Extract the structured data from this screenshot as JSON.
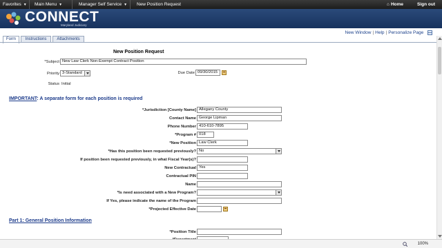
{
  "topnav": {
    "favorites": "Favorites",
    "main_menu": "Main Menu",
    "manager_self_service": "Manager Self Service",
    "breadcrumb_current": "New Position Request",
    "home": "Home",
    "sign_out": "Sign out"
  },
  "brand": {
    "name": "CONNECT",
    "subtitle": "Maryland Judiciary"
  },
  "utility": {
    "new_window": "New Window",
    "help": "Help",
    "personalize": "Personalize Page"
  },
  "tabs": [
    {
      "label": "Form"
    },
    {
      "label": "Instructions"
    },
    {
      "label": "Attachments"
    }
  ],
  "form": {
    "title": "New Position Request",
    "subject_label": "*Subject",
    "subject_value": "New Law Clerk Non-Exempt Contract Position",
    "priority_label": "Priority",
    "priority_value": "3-Standard",
    "due_date_label": "Due Date",
    "due_date_value": "09/30/2015",
    "status_label": "Status",
    "status_value": "Initial"
  },
  "important": {
    "heading_u": "IMPORTANT",
    "heading_rest": ": A separate form for each position is required",
    "jurisdiction_label": "*Jurisdiction [County Name]",
    "jurisdiction_value": "Allegany County",
    "contact_label": "Contact Name",
    "contact_value": "George Lipman",
    "phone_label": "Phone Number",
    "phone_value": "410-610-7895",
    "program_label": "*Program #",
    "program_value": "018",
    "new_position_label": "*New Position",
    "new_position_value": "Law Clerk",
    "requested_label": "*Has this position been requested previously?",
    "requested_value": "No",
    "fiscal_label": "If position been requested previously, in what Fiscal Year(s)?",
    "fiscal_value": "",
    "new_contractual_label": "New Contractual",
    "new_contractual_value": "Yes",
    "contractual_pin_label": "Contractual PIN",
    "contractual_pin_value": "",
    "name_label": "Name",
    "name_value": "",
    "new_program_label": "*Is need associated with a New Program?",
    "new_program_value": "",
    "program_name_label": "If Yes, please indicate the name of the Program",
    "program_name_value": "",
    "effective_date_label": "*Projected Effective Date",
    "effective_date_value": ""
  },
  "part1": {
    "heading": "Part 1: General Position Information",
    "position_title_label": "*Position Title",
    "position_title_value": "",
    "department_label": "*Department",
    "department_value": ""
  },
  "statusbar": {
    "zoom": "100%"
  },
  "colors": {
    "brand": "#1f3d6e",
    "link": "#1a3f8a",
    "topnav": "#2a2a2a"
  }
}
